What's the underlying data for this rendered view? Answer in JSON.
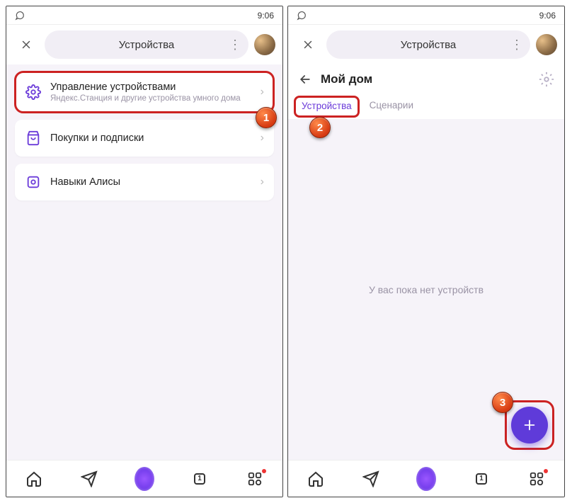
{
  "statusbar": {
    "time": "9:06"
  },
  "header": {
    "title": "Устройства",
    "close_label": "×"
  },
  "screen1": {
    "cards": [
      {
        "title": "Управление устройствами",
        "sub": "Яндекс.Станция и другие устройства умного дома"
      },
      {
        "title": "Покупки и подписки"
      },
      {
        "title": "Навыки Алисы"
      }
    ]
  },
  "screen2": {
    "home_title": "Мой дом",
    "tabs": {
      "devices": "Устройства",
      "scenarios": "Сценарии"
    },
    "empty": "У вас пока нет устройств"
  },
  "badges": {
    "one": "1",
    "two": "2",
    "three": "3"
  },
  "nav": {
    "tabs_badge": "1"
  }
}
